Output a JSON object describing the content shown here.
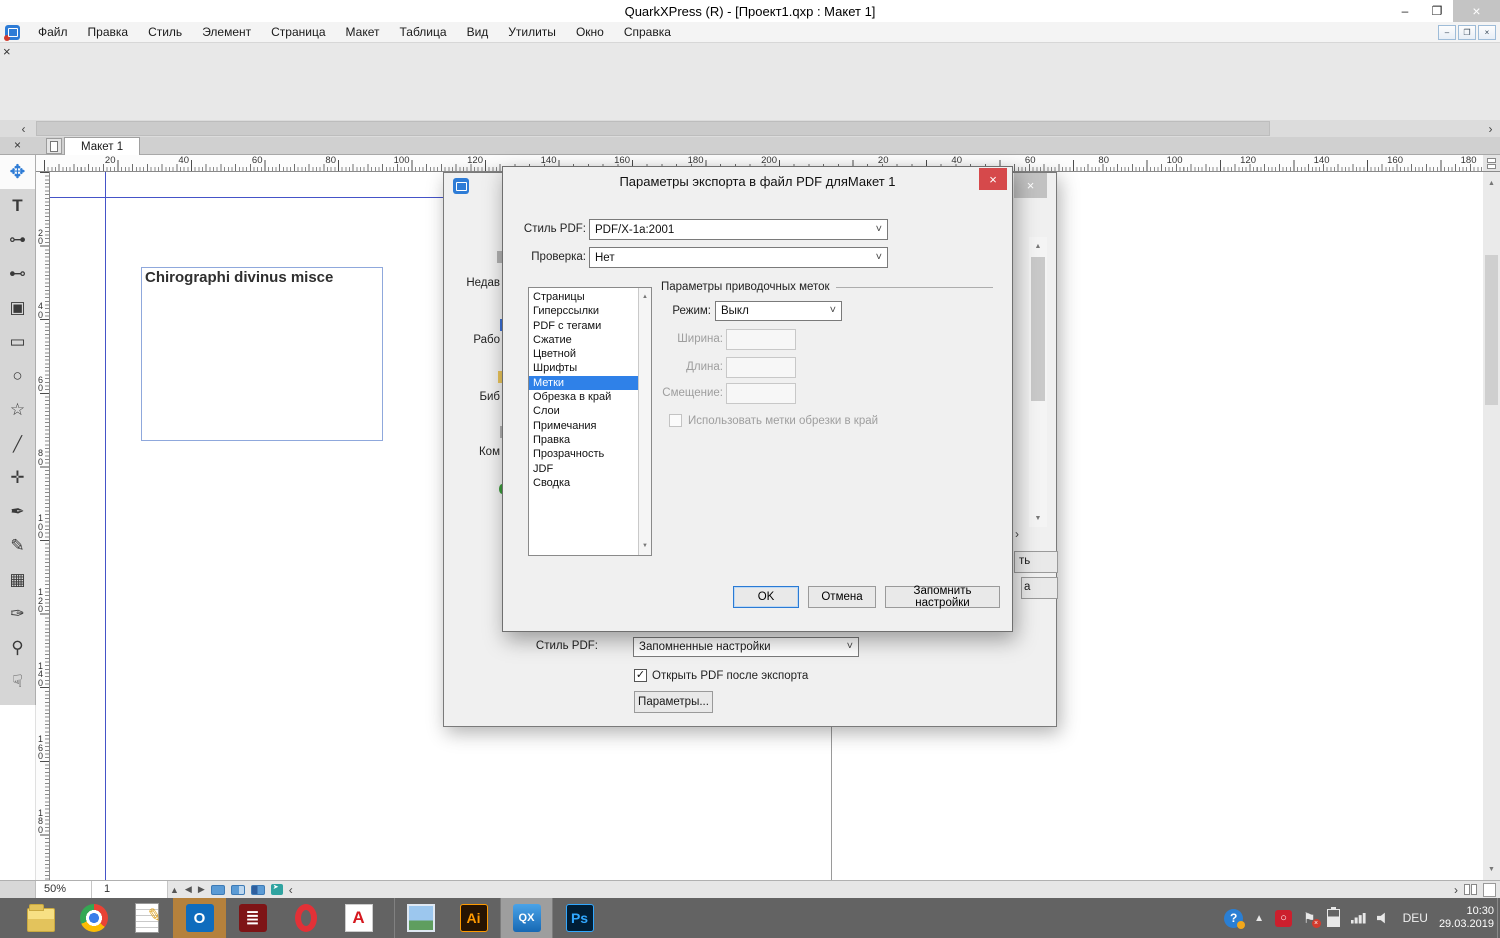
{
  "window": {
    "title": "QuarkXPress (R) - [Проект1.qxp : Макет 1]",
    "minimize": "–",
    "restore": "❐",
    "close": "×"
  },
  "menubar": {
    "items": [
      "Файл",
      "Правка",
      "Стиль",
      "Элемент",
      "Страница",
      "Макет",
      "Таблица",
      "Вид",
      "Утилиты",
      "Окно",
      "Справка"
    ],
    "mdi_minimize": "–",
    "mdi_restore": "❐",
    "mdi_close": "×"
  },
  "tabbar": {
    "close": "×",
    "active_tab": "Макет 1"
  },
  "rulers": {
    "h_page1": [
      "20",
      "40",
      "60",
      "80",
      "100",
      "120",
      "140",
      "160",
      "180",
      "200"
    ],
    "h_page2": [
      "20",
      "40",
      "60",
      "80",
      "100",
      "120",
      "140",
      "160",
      "180"
    ],
    "vertical": [
      "20",
      "40",
      "60",
      "80",
      "100",
      "120",
      "140",
      "160",
      "180"
    ]
  },
  "toolbar": {
    "tools": [
      {
        "name": "move-tool",
        "glyph": "✥",
        "state": "selected"
      },
      {
        "name": "text-tool",
        "glyph": "T",
        "state": ""
      },
      {
        "name": "link-tool",
        "glyph": "⊶",
        "state": ""
      },
      {
        "name": "unlink-tool",
        "glyph": "⊷",
        "state": ""
      },
      {
        "name": "picture-box-tool",
        "glyph": "▣",
        "state": ""
      },
      {
        "name": "rectangle-tool",
        "glyph": "▭",
        "state": ""
      },
      {
        "name": "oval-tool",
        "glyph": "○",
        "state": ""
      },
      {
        "name": "star-tool",
        "glyph": "☆",
        "state": ""
      },
      {
        "name": "line-tool",
        "glyph": "╱",
        "state": ""
      },
      {
        "name": "point-tool",
        "glyph": "✛",
        "state": ""
      },
      {
        "name": "bezier-tool",
        "glyph": "✒",
        "state": ""
      },
      {
        "name": "freehand-tool",
        "glyph": "✎",
        "state": ""
      },
      {
        "name": "table-tool",
        "glyph": "▦",
        "state": ""
      },
      {
        "name": "eyedropper-tool",
        "glyph": "✑",
        "state": ""
      },
      {
        "name": "zoom-tool",
        "glyph": "⚲",
        "state": ""
      },
      {
        "name": "hand-tool",
        "glyph": "☟",
        "state": ""
      }
    ]
  },
  "canvas": {
    "textbox_text": "Chirographi divinus misce"
  },
  "statusbar": {
    "zoom": "50%",
    "page": "1"
  },
  "export_dialog": {
    "close": "×",
    "sidebar": [
      "Недав",
      "Рабо",
      "Биб",
      "Ком"
    ],
    "save_button_fragment": "ть",
    "cancel_button_fragment": "а",
    "pdf_style_label": "Стиль PDF:",
    "pdf_style_value": "Запомненные настройки",
    "open_after_label": "Открыть PDF после экспорта",
    "open_after_check": "✓",
    "options_button": "Параметры..."
  },
  "options_dialog": {
    "title": "Параметры экспорта в файл PDF дляМакет 1",
    "close": "×",
    "pdf_style_label": "Стиль PDF:",
    "pdf_style_value": "PDF/X-1a:2001",
    "verification_label": "Проверка:",
    "verification_value": "Нет",
    "sections": [
      {
        "label": "Страницы",
        "state": ""
      },
      {
        "label": "Гиперссылки",
        "state": ""
      },
      {
        "label": "PDF с тегами",
        "state": ""
      },
      {
        "label": "Сжатие",
        "state": ""
      },
      {
        "label": "Цветной",
        "state": ""
      },
      {
        "label": "Шрифты",
        "state": ""
      },
      {
        "label": "Метки",
        "state": "selected"
      },
      {
        "label": "Обрезка в край",
        "state": ""
      },
      {
        "label": "Слои",
        "state": ""
      },
      {
        "label": "Примечания",
        "state": ""
      },
      {
        "label": "Правка",
        "state": ""
      },
      {
        "label": "Прозрачность",
        "state": ""
      },
      {
        "label": "JDF",
        "state": ""
      },
      {
        "label": "Сводка",
        "state": ""
      }
    ],
    "marks_panel": {
      "group_title": "Параметры приводочных меток",
      "mode_label": "Режим:",
      "mode_value": "Выкл",
      "width_label": "Ширина:",
      "length_label": "Длина:",
      "offset_label": "Смещение:",
      "bleed_checkbox_label": "Использовать метки обрезки в край"
    },
    "ok_button": "OK",
    "cancel_button": "Отмена",
    "save_settings_button": "Запомнить настройки"
  },
  "taskbar": {
    "apps": [
      {
        "name": "file-explorer",
        "glyph": "",
        "state": ""
      },
      {
        "name": "chrome",
        "glyph": "",
        "state": ""
      },
      {
        "name": "notepad",
        "glyph": "",
        "state": ""
      },
      {
        "name": "outlook",
        "glyph": "O",
        "state": "highlighted"
      },
      {
        "name": "ebook-reader",
        "glyph": "≣",
        "state": ""
      },
      {
        "name": "opera",
        "glyph": "",
        "state": ""
      },
      {
        "name": "acrobat-reader",
        "glyph": "A",
        "state": ""
      },
      {
        "name": "photo-viewer",
        "glyph": "",
        "state": ""
      },
      {
        "name": "illustrator",
        "glyph": "Ai",
        "state": ""
      },
      {
        "name": "quarkxpress",
        "glyph": "QX",
        "state": "active"
      },
      {
        "name": "photoshop",
        "glyph": "Ps",
        "state": ""
      }
    ],
    "tray": {
      "lang": "DEU",
      "time": "10:30",
      "date": "29.03.2019"
    }
  },
  "colors": {
    "selection_blue": "#2f81e8",
    "close_red": "#d6494b",
    "guide_blue": "#4553c8",
    "default_button_border": "#2a7ad4",
    "taskbar_gray": "#636363"
  }
}
